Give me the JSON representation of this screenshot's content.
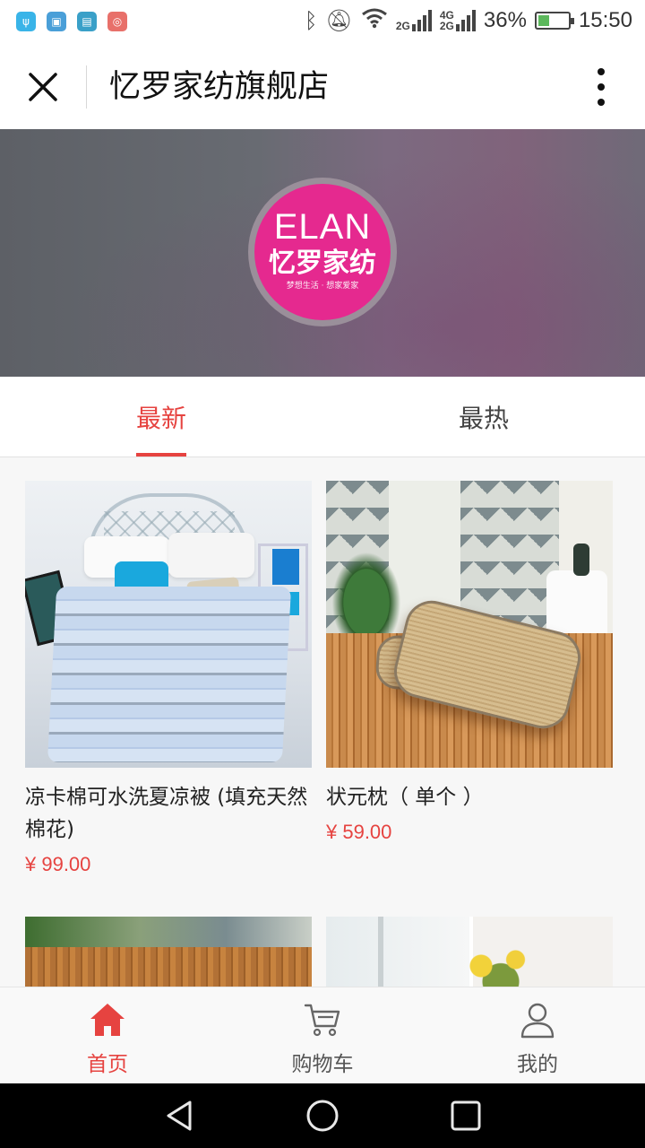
{
  "status_bar": {
    "battery": "36%",
    "time": "15:50",
    "net_top": "2G",
    "net_4g": "4G",
    "net_2g": "2G",
    "signal_icons": [
      "usb-icon",
      "gallery-icon",
      "phone-manager-icon",
      "app-icon",
      "bluetooth-icon",
      "mute-icon",
      "wifi-icon",
      "signal-icon",
      "battery-icon"
    ]
  },
  "title_bar": {
    "title": "忆罗家纺旗舰店"
  },
  "banner": {
    "logo_en": "ELAN",
    "logo_cn": "忆罗家纺",
    "logo_slogan": "梦想生活 · 想家爱家",
    "logo_color": "#e5298f"
  },
  "tabs": [
    {
      "label": "最新",
      "active": true
    },
    {
      "label": "最热",
      "active": false
    }
  ],
  "products": [
    {
      "name": "凉卡棉可水洗夏凉被 (填充天然棉花)",
      "price": "¥ 99.00"
    },
    {
      "name": "状元枕（ 单个 ）",
      "price": "¥ 59.00"
    }
  ],
  "bottom_nav": [
    {
      "label": "首页",
      "icon": "home-icon",
      "active": true
    },
    {
      "label": "购物车",
      "icon": "cart-icon",
      "active": false
    },
    {
      "label": "我的",
      "icon": "user-icon",
      "active": false
    }
  ],
  "colors": {
    "accent": "#e64340"
  }
}
